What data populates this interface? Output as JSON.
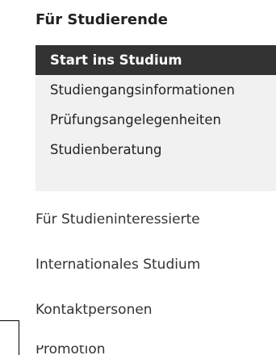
{
  "nav": {
    "section_title": "Für Studierende",
    "sub_items": [
      {
        "label": "Start ins Studium"
      },
      {
        "label": "Studiengangsinformationen"
      },
      {
        "label": "Prüfungsangelegenheiten"
      },
      {
        "label": "Studienberatung"
      }
    ],
    "main_items": [
      {
        "label": "Für Studieninteressierte"
      },
      {
        "label": "Internationales Studium"
      },
      {
        "label": "Kontaktpersonen"
      },
      {
        "label": "Promotion"
      }
    ]
  }
}
